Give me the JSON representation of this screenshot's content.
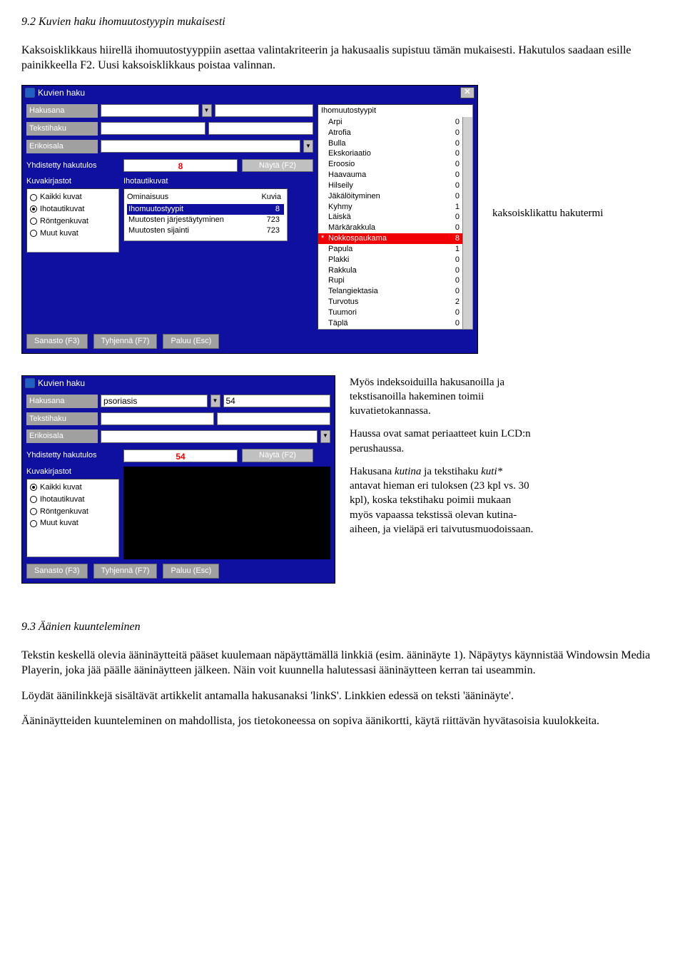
{
  "sec92": {
    "title": "9.2 Kuvien haku ihomuutostyypin mukaisesti",
    "p1": "Kaksoisklikkaus hiirellä ihomuutostyyppiin asettaa valintakriteerin ja hakusaalis supistuu tämän mukaisesti. Hakutulos saadaan esille painikkeella F2. Uusi kaksoisklikkaus poistaa valinnan."
  },
  "win1": {
    "title": "Kuvien haku",
    "close": "✕",
    "labels": {
      "hakusana": "Hakusana",
      "tekstihaku": "Tekstihaku",
      "erikoisala": "Erikoisala",
      "yhd": "Yhdistetty hakutulos",
      "nayta": "Näytä (F2)",
      "kuvakirj": "Kuvakirjastot",
      "ihok": "Ihotautikuvat",
      "om": "Ominaisuus",
      "kuvia": "Kuvia"
    },
    "yhd_value": "8",
    "radios": {
      "r1": "Kaikki kuvat",
      "r2": "Ihotautikuvat",
      "r3": "Röntgenkuvat",
      "r4": "Muut kuvat"
    },
    "om_rows": [
      {
        "name": "Ihomuutostyypit",
        "val": "8",
        "sel": true
      },
      {
        "name": "Muutosten järjestäytyminen",
        "val": "723"
      },
      {
        "name": "Muutosten sijainti",
        "val": "723"
      }
    ],
    "right_title": "Ihomuutostyypit",
    "right_rows": [
      {
        "name": "Arpi",
        "val": "0"
      },
      {
        "name": "Atrofia",
        "val": "0"
      },
      {
        "name": "Bulla",
        "val": "0"
      },
      {
        "name": "Ekskoriaatio",
        "val": "0"
      },
      {
        "name": "Eroosio",
        "val": "0"
      },
      {
        "name": "Haavauma",
        "val": "0"
      },
      {
        "name": "Hilseily",
        "val": "0"
      },
      {
        "name": "Jäkälöityminen",
        "val": "0"
      },
      {
        "name": "Kyhmy",
        "val": "1"
      },
      {
        "name": "Läiskä",
        "val": "0"
      },
      {
        "name": "Märkärakkula",
        "val": "0"
      },
      {
        "name": "Nokkospaukama",
        "val": "8",
        "hl": true,
        "star": "*"
      },
      {
        "name": "Papula",
        "val": "1"
      },
      {
        "name": "Plakki",
        "val": "0"
      },
      {
        "name": "Rakkula",
        "val": "0"
      },
      {
        "name": "Rupi",
        "val": "0"
      },
      {
        "name": "Telangiektasia",
        "val": "0"
      },
      {
        "name": "Turvotus",
        "val": "2"
      },
      {
        "name": "Tuumori",
        "val": "0"
      },
      {
        "name": "Täplä",
        "val": "0"
      }
    ],
    "foot": {
      "f3": "Sanasto (F3)",
      "f7": "Tyhjennä (F7)",
      "esc": "Paluu (Esc)"
    }
  },
  "anno1": {
    "txt": "kaksoisklikattu hakutermi"
  },
  "win2": {
    "title": "Kuvien haku",
    "hakusana_val": "psoriasis",
    "hakusana_count": "54",
    "yhd_value": "54"
  },
  "anno2": {
    "p1": "Myös indeksoiduilla hakusanoilla ja tekstisanoilla hakeminen toimii kuvatietokannassa.",
    "p2": "Haussa ovat samat periaatteet kuin LCD:n perushaussa.",
    "p3a": "Hakusana ",
    "p3b": "kutina",
    "p3c": " ja tekstihaku ",
    "p3d": "kuti*",
    "p3e": " antavat hieman eri tuloksen (23 kpl vs. 30 kpl), koska tekstihaku poimii mukaan myös vapaassa tekstissä olevan kutina-aiheen, ja vieläpä eri taivutusmuodoissaan."
  },
  "sec93": {
    "title": "9.3 Äänien kuunteleminen",
    "p1": "Tekstin keskellä olevia ääninäytteitä pääset kuulemaan näpäyttämällä linkkiä (esim. ääninäyte 1). Näpäytys käynnistää Windowsin Media Playerin, joka jää päälle ääninäytteen jälkeen. Näin voit kuunnella halutessasi ääninäytteen kerran tai useammin.",
    "p2": "Löydät äänilinkkejä sisältävät artikkelit antamalla hakusanaksi 'linkS'. Linkkien edessä on teksti 'ääninäyte'.",
    "p3": "Ääninäytteiden kuunteleminen on mahdollista, jos tietokoneessa on sopiva äänikortti, käytä riittävän hyvätasoisia kuulokkeita."
  }
}
